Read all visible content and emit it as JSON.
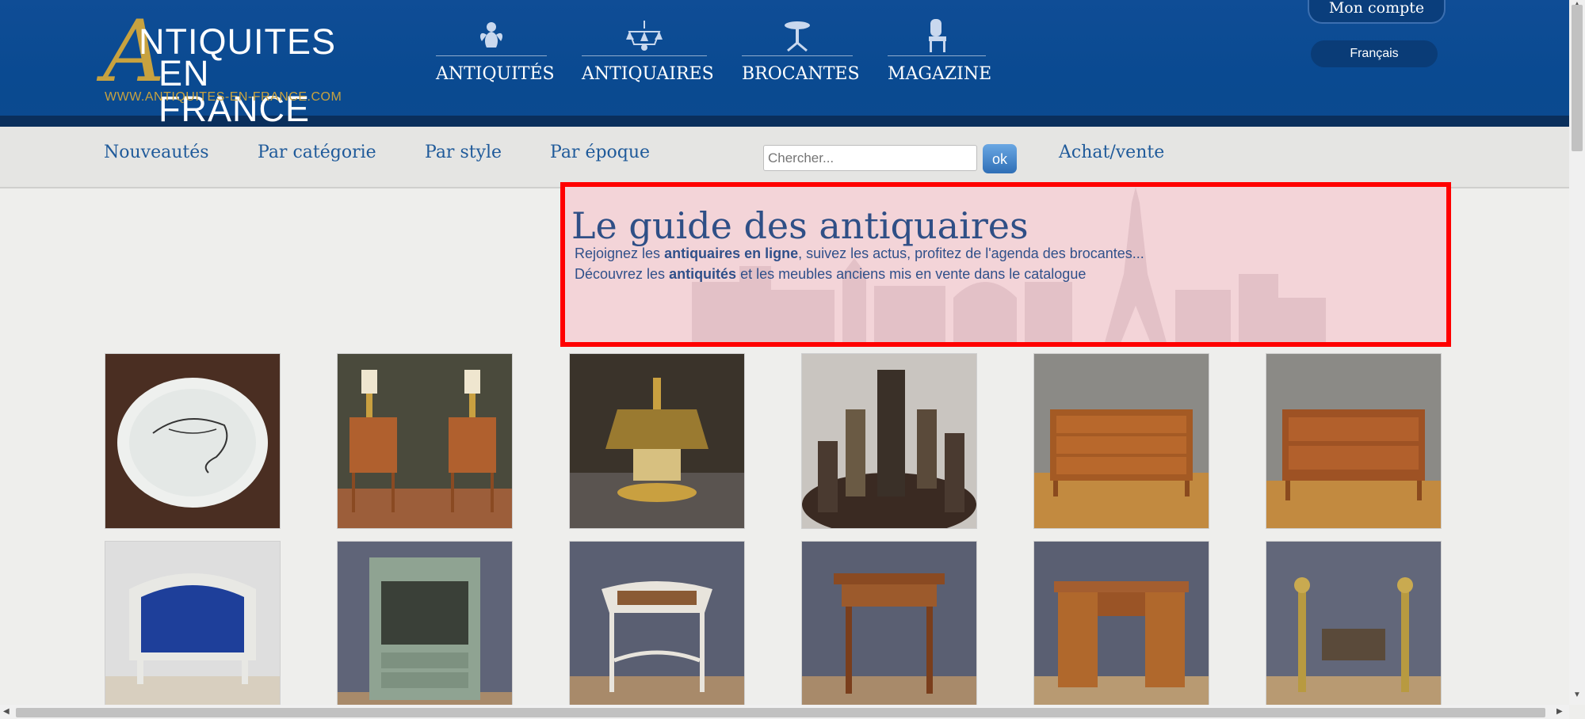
{
  "logo": {
    "line1": "NTIQUITES",
    "line2": "EN FRANCE",
    "letter": "A",
    "url": "WWW.ANTIQUITES-EN-FRANCE.COM"
  },
  "main_nav": [
    {
      "label": "ANTIQUITÉS",
      "icon": "cherub-icon"
    },
    {
      "label": "ANTIQUAIRES",
      "icon": "chandelier-icon"
    },
    {
      "label": "BROCANTES",
      "icon": "table-icon"
    },
    {
      "label": "MAGAZINE",
      "icon": "chair-icon"
    }
  ],
  "account": {
    "label": "Mon compte"
  },
  "language": {
    "label": "Français"
  },
  "sub_nav": [
    {
      "label": "Nouveautés"
    },
    {
      "label": "Par catégorie"
    },
    {
      "label": "Par style"
    },
    {
      "label": "Par époque"
    },
    {
      "label": "Achat/vente"
    }
  ],
  "search": {
    "placeholder": "Chercher...",
    "button_label": "ok"
  },
  "guide": {
    "title": "Le guide des antiquaires",
    "line1_pre": "Rejoignez les ",
    "line1_bold": "antiquaires en ligne",
    "line1_post": ", suivez les actus, profitez de l'agenda des brocantes...",
    "line2_pre": "Découvrez les ",
    "line2_bold": "antiquités",
    "line2_post": " et les meubles anciens mis en vente dans le catalogue"
  },
  "products": [
    {
      "name": "plate-drawing"
    },
    {
      "name": "bedside-tables-pair"
    },
    {
      "name": "bouillotte-lamp"
    },
    {
      "name": "ceramic-vases"
    },
    {
      "name": "chest-of-drawers-3"
    },
    {
      "name": "chest-of-drawers-2"
    },
    {
      "name": "blue-bergere-armchair"
    },
    {
      "name": "painted-display-cabinet"
    },
    {
      "name": "caned-dressing-table"
    },
    {
      "name": "small-side-table"
    },
    {
      "name": "pedestal-desk"
    },
    {
      "name": "brass-andirons"
    }
  ],
  "colors": {
    "header": "#0f4d96",
    "accent_gold": "#c8a23f",
    "nav_link": "#1f5a9a",
    "highlight_border": "#ff0000"
  }
}
